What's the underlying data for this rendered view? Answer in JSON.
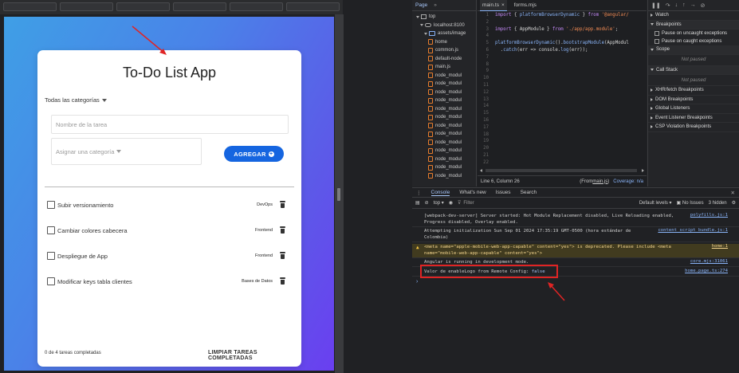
{
  "app": {
    "title": "To-Do List App",
    "category_filter": "Todas las categorías",
    "task_placeholder": "Nombre de la tarea",
    "assign_placeholder": "Asignar una categoría",
    "add_button": "AGREGAR",
    "tasks": [
      {
        "name": "Subir versionamiento",
        "category": "DevOps"
      },
      {
        "name": "Cambiar colores cabecera",
        "category": "Frontend"
      },
      {
        "name": "Despliegue de App",
        "category": "Frontend"
      },
      {
        "name": "Modificar keys tabla clientes",
        "category": "Bases de Datos"
      }
    ],
    "footer_count": "0 de 4 tareas completadas",
    "clear_button": "LIMPIAR TAREAS COMPLETADAS"
  },
  "devtools": {
    "nav_tabs": [
      "Page",
      "»"
    ],
    "tree": [
      {
        "label": "top",
        "type": "frame",
        "indent": 1
      },
      {
        "label": "localhost:8100",
        "type": "cloud",
        "indent": 2
      },
      {
        "label": "assets/image",
        "type": "folder",
        "indent": 3
      },
      {
        "label": "home",
        "type": "file",
        "indent": 4
      },
      {
        "label": "common.js",
        "type": "file",
        "indent": 4
      },
      {
        "label": "default-node",
        "type": "file",
        "indent": 4
      },
      {
        "label": "main.js",
        "type": "file",
        "indent": 4
      },
      {
        "label": "node_modul",
        "type": "file",
        "indent": 4
      },
      {
        "label": "node_modul",
        "type": "file",
        "indent": 4
      },
      {
        "label": "node_modul",
        "type": "file",
        "indent": 4
      },
      {
        "label": "node_modul",
        "type": "file",
        "indent": 4
      },
      {
        "label": "node_modul",
        "type": "file",
        "indent": 4
      },
      {
        "label": "node_modul",
        "type": "file",
        "indent": 4
      },
      {
        "label": "node_modul",
        "type": "file",
        "indent": 4
      },
      {
        "label": "node_modul",
        "type": "file",
        "indent": 4
      },
      {
        "label": "node_modul",
        "type": "file",
        "indent": 4
      },
      {
        "label": "node_modul",
        "type": "file",
        "indent": 4
      },
      {
        "label": "node_modul",
        "type": "file",
        "indent": 4
      },
      {
        "label": "node_modul",
        "type": "file",
        "indent": 4
      },
      {
        "label": "node_modul",
        "type": "file",
        "indent": 4
      }
    ],
    "editor_tabs": [
      "main.ts",
      "forms.mjs"
    ],
    "code": [
      "import { platformBrowserDynamic } from '@angular/",
      "",
      "import { AppModule } from './app/app.module';",
      "",
      "platformBrowserDynamic().bootstrapModule(AppModul",
      "  .catch(err => console.log(err));",
      "",
      "",
      "",
      "",
      "",
      "",
      "",
      "",
      "",
      "",
      "",
      "",
      "",
      "",
      "",
      ""
    ],
    "status_pos": "Line 6, Column 26",
    "status_from": "(From ",
    "status_file": "main.js",
    "status_close": ")",
    "status_coverage": "Coverage: n/a",
    "debugger": {
      "watch": "Watch",
      "breakpoints": "Breakpoints",
      "pause_uncaught": "Pause on uncaught exceptions",
      "pause_caught": "Pause on caught exceptions",
      "scope": "Scope",
      "not_paused_1": "Not paused",
      "call_stack": "Call Stack",
      "not_paused_2": "Not paused",
      "xhr": "XHR/fetch Breakpoints",
      "dom": "DOM Breakpoints",
      "global": "Global Listeners",
      "event": "Event Listener Breakpoints",
      "csp": "CSP Violation Breakpoints"
    },
    "console_tabs": [
      "Console",
      "What's new",
      "Issues",
      "Search"
    ],
    "console_context": "top",
    "console_filter": "Filter",
    "console_levels": "Default levels",
    "console_issues": "No Issues",
    "console_hidden": "3 hidden",
    "messages": [
      {
        "text": "[webpack-dev-server] Server started: Hot Module Replacement disabled, Live Reloading enabled,\nProgress disabled, Overlay enabled.",
        "src": "polyfills.js:1"
      },
      {
        "text": "Attempting initialization Sun Sep 01 2024 17:35:19 GMT-0500 (hora estándar de\nColombia)",
        "src": "content script bundle.js:1"
      },
      {
        "text": "<meta name=\"apple-mobile-web-app-capable\" content=\"yes\"> is deprecated. Please include <meta\nname=\"mobile-web-app-capable\" content=\"yes\">",
        "src": "home:1",
        "warn": true
      },
      {
        "text": "Angular is running in development mode.",
        "src": "core.mjs:31061"
      },
      {
        "text": "Valor de enableLogo from Remote Config: ",
        "value": "false",
        "src": "home.page.ts:274"
      }
    ]
  }
}
